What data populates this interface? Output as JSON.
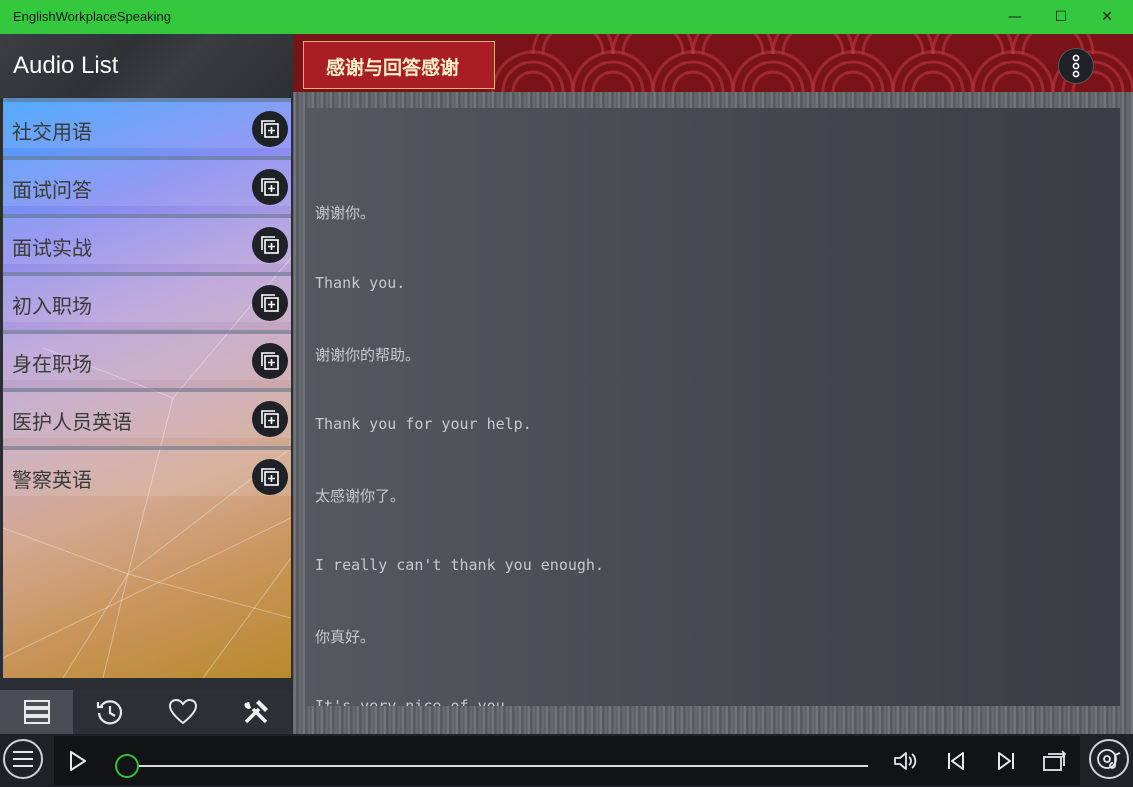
{
  "window": {
    "title": "EnglishWorkplaceSpeaking",
    "minimize_glyph": "—",
    "maximize_glyph": "☐",
    "close_glyph": "✕"
  },
  "sidebar": {
    "title": "Audio List",
    "items": [
      {
        "label": "社交用语"
      },
      {
        "label": "面试问答"
      },
      {
        "label": "面试实战"
      },
      {
        "label": "初入职场"
      },
      {
        "label": "身在职场"
      },
      {
        "label": "医护人员英语"
      },
      {
        "label": "警察英语"
      }
    ],
    "tabs": [
      {
        "icon": "list-icon",
        "active": true
      },
      {
        "icon": "history-icon",
        "active": false
      },
      {
        "icon": "heart-icon",
        "active": false
      },
      {
        "icon": "tools-icon",
        "active": false
      }
    ]
  },
  "main": {
    "banner_title": "感谢与回答感谢",
    "lines": [
      "谢谢你。",
      "Thank you.",
      "谢谢你的帮助。",
      "Thank you for your help.",
      "太感谢你了。",
      "I really can't thank you enough.",
      "你真好。",
      "It's very nice of you."
    ]
  },
  "player": {
    "progress": 0
  },
  "colors": {
    "titlebar": "#34c83f",
    "accent": "#2fc33c",
    "banner_red": "#7a1219"
  }
}
